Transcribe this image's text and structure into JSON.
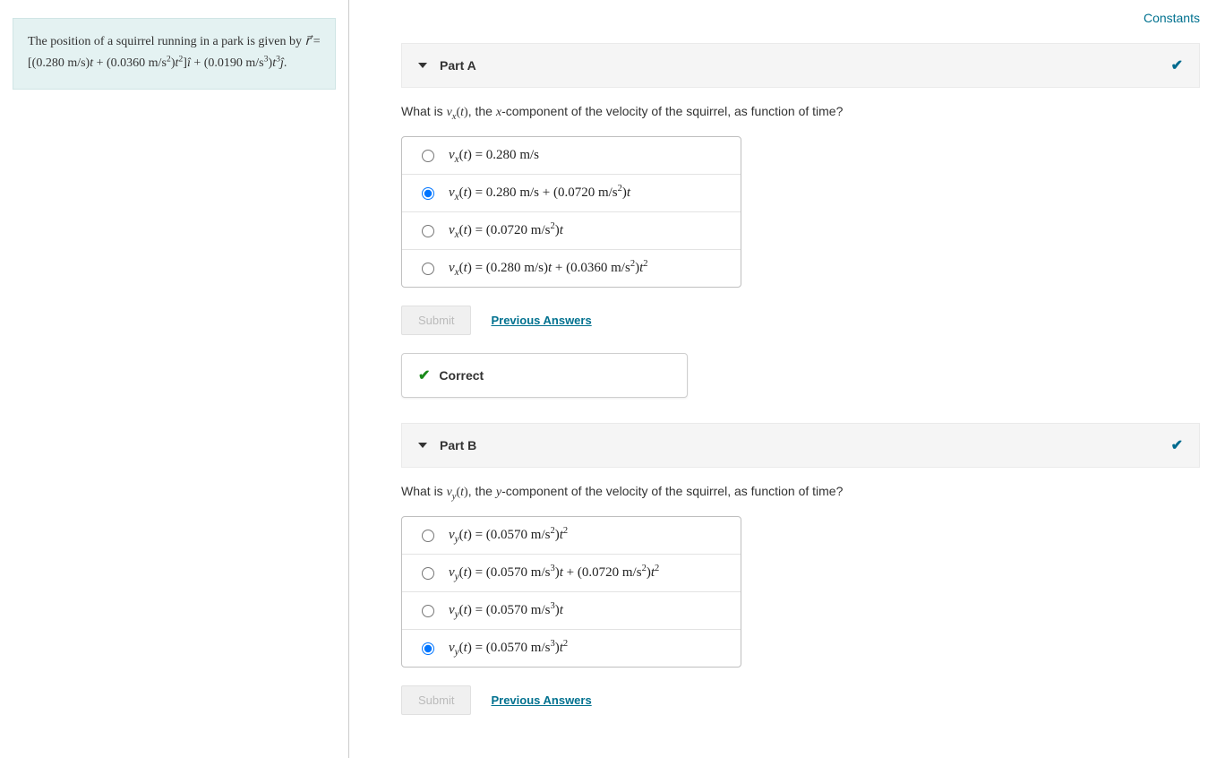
{
  "topLinks": {
    "constants": "Constants"
  },
  "problem": {
    "intro_html": "The position of a squirrel running in a park is given by <span class='math'><span class='ital'>r&#8407;</span> = [(0.280 m/s)<span class='ital'>t</span> + (0.0360 m/s<sup>2</sup>)<span class='ital'>t</span><sup>2</sup>]<span class='ital'>i&#770;</span> + (0.0190 m/s<sup>3</sup>)<span class='ital'>t</span><sup>3</sup><span class='ital'>j&#770;</span>.</span>"
  },
  "partA": {
    "title": "Part A",
    "question_html": "What is <span class='math'><span class='ital'>v</span><sub>x</sub>(<span class='ital'>t</span>)</span>, the <span class='math ital'>x</span>-component of the velocity of the squirrel, as function of time?",
    "choices": [
      "<span class='ital'>v</span><sub>x</sub>(<span class='ital'>t</span>) = 0.280 <span class='unit'>m/s</span>",
      "<span class='ital'>v</span><sub>x</sub>(<span class='ital'>t</span>) = 0.280 <span class='unit'>m/s</span> + (0.0720 <span class='unit'>m/s</span><sup>2</sup>)<span class='ital'>t</span>",
      "<span class='ital'>v</span><sub>x</sub>(<span class='ital'>t</span>) = (0.0720 <span class='unit'>m/s</span><sup>2</sup>)<span class='ital'>t</span>",
      "<span class='ital'>v</span><sub>x</sub>(<span class='ital'>t</span>) = (0.280 <span class='unit'>m/s</span>)<span class='ital'>t</span> + (0.0360 <span class='unit'>m/s</span><sup>2</sup>)<span class='ital'>t</span><sup>2</sup>"
    ],
    "selectedIndex": 1,
    "submitLabel": "Submit",
    "prevAnswersLabel": "Previous Answers",
    "resultLabel": "Correct"
  },
  "partB": {
    "title": "Part B",
    "question_html": "What is <span class='math'><span class='ital'>v</span><sub>y</sub>(<span class='ital'>t</span>)</span>, the <span class='math ital'>y</span>-component of the velocity of the squirrel, as function of time?",
    "choices": [
      "<span class='ital'>v</span><sub>y</sub>(<span class='ital'>t</span>) = (0.0570 <span class='unit'>m/s</span><sup>2</sup>)<span class='ital'>t</span><sup>2</sup>",
      "<span class='ital'>v</span><sub>y</sub>(<span class='ital'>t</span>) = (0.0570 <span class='unit'>m/s</span><sup>3</sup>)<span class='ital'>t</span> + (0.0720 <span class='unit'>m/s</span><sup>2</sup>)<span class='ital'>t</span><sup>2</sup>",
      "<span class='ital'>v</span><sub>y</sub>(<span class='ital'>t</span>) = (0.0570 <span class='unit'>m/s</span><sup>3</sup>)<span class='ital'>t</span>",
      "<span class='ital'>v</span><sub>y</sub>(<span class='ital'>t</span>) = (0.0570 <span class='unit'>m/s</span><sup>3</sup>)<span class='ital'>t</span><sup>2</sup>"
    ],
    "selectedIndex": 3,
    "submitLabel": "Submit",
    "prevAnswersLabel": "Previous Answers"
  }
}
